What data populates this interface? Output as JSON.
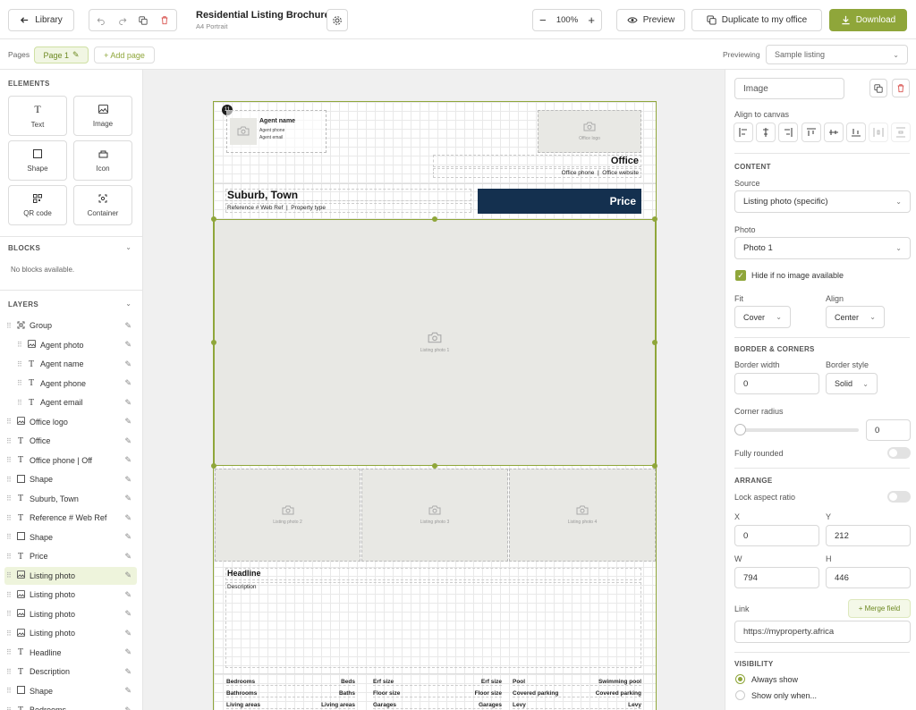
{
  "topbar": {
    "library_label": "Library",
    "doc_title": "Residential Listing Brochure",
    "doc_subtitle": "A4 Portrait",
    "zoom": "100%",
    "preview_label": "Preview",
    "duplicate_label": "Duplicate to my office",
    "download_label": "Download",
    "accent": "#8fa63a"
  },
  "pages_bar": {
    "pages_label": "Pages",
    "current_page": "Page 1",
    "add_page_label": "+ Add page",
    "previewing_label": "Previewing",
    "previewing_value": "Sample listing"
  },
  "left_panel": {
    "elements_title": "ELEMENTS",
    "elements": [
      {
        "label": "Text",
        "icon": "text-icon"
      },
      {
        "label": "Image",
        "icon": "image-icon"
      },
      {
        "label": "Shape",
        "icon": "shape-icon"
      },
      {
        "label": "Icon",
        "icon": "icon-icon"
      },
      {
        "label": "QR code",
        "icon": "qr-icon"
      },
      {
        "label": "Container",
        "icon": "container-icon"
      }
    ],
    "blocks_title": "BLOCKS",
    "blocks_empty": "No blocks available.",
    "layers_title": "LAYERS",
    "layers": [
      {
        "label": "Group",
        "icon": "group-icon",
        "indent": 0
      },
      {
        "label": "Agent photo",
        "icon": "image-icon",
        "indent": 1
      },
      {
        "label": "Agent name",
        "icon": "text-icon",
        "indent": 1
      },
      {
        "label": "Agent phone",
        "icon": "text-icon",
        "indent": 1
      },
      {
        "label": "Agent email",
        "icon": "text-icon",
        "indent": 1
      },
      {
        "label": "Office logo",
        "icon": "image-icon",
        "indent": 0
      },
      {
        "label": "Office",
        "icon": "text-icon",
        "indent": 0
      },
      {
        "label": "Office phone | Off",
        "icon": "text-icon",
        "indent": 0
      },
      {
        "label": "Shape",
        "icon": "shape-icon",
        "indent": 0
      },
      {
        "label": "Suburb, Town",
        "icon": "text-icon",
        "indent": 0
      },
      {
        "label": "Reference # Web Ref",
        "icon": "text-icon",
        "indent": 0
      },
      {
        "label": "Shape",
        "icon": "shape-icon",
        "indent": 0
      },
      {
        "label": "Price",
        "icon": "text-icon",
        "indent": 0
      },
      {
        "label": "Listing photo",
        "icon": "image-icon",
        "indent": 0,
        "selected": true
      },
      {
        "label": "Listing photo",
        "icon": "image-icon",
        "indent": 0
      },
      {
        "label": "Listing photo",
        "icon": "image-icon",
        "indent": 0
      },
      {
        "label": "Listing photo",
        "icon": "image-icon",
        "indent": 0
      },
      {
        "label": "Headline",
        "icon": "text-icon",
        "indent": 0
      },
      {
        "label": "Description",
        "icon": "text-icon",
        "indent": 0
      },
      {
        "label": "Shape",
        "icon": "shape-icon",
        "indent": 0
      },
      {
        "label": "Bedrooms",
        "icon": "text-icon",
        "indent": 0
      }
    ]
  },
  "canvas": {
    "badge": "11",
    "agent_name": "Agent name",
    "agent_phone": "Agent phone",
    "agent_email": "Agent email",
    "office_logo": "Office logo",
    "office": "Office",
    "office_contact": "Office phone  |  Office website",
    "suburb": "Suburb, Town",
    "reference": "Reference # Web Ref  |  Property type",
    "price": "Price",
    "price_bg": "#14304f",
    "photo_main": "Listing photo 1",
    "photo_2": "Listing photo 2",
    "photo_3": "Listing photo 3",
    "photo_4": "Listing photo 4",
    "headline": "Headline",
    "description": "Description",
    "features": [
      [
        "Bedrooms",
        "Beds",
        "Erf size",
        "Erf size",
        "Pool",
        "Swimming pool"
      ],
      [
        "Bathrooms",
        "Baths",
        "Floor size",
        "Floor size",
        "Covered parking",
        "Covered parking"
      ],
      [
        "Living areas",
        "Living areas",
        "Garages",
        "Garages",
        "Levy",
        "Levy"
      ]
    ]
  },
  "right_panel": {
    "element_name": "Image",
    "align_label": "Align to canvas",
    "content_title": "CONTENT",
    "source_label": "Source",
    "source_value": "Listing photo (specific)",
    "photo_label": "Photo",
    "photo_value": "Photo 1",
    "hide_label": "Hide if no image available",
    "hide_checked": true,
    "fit_label": "Fit",
    "fit_value": "Cover",
    "align_field_label": "Align",
    "align_value": "Center",
    "border_title": "BORDER & CORNERS",
    "border_width_label": "Border width",
    "border_width_value": "0",
    "border_style_label": "Border style",
    "border_style_value": "Solid",
    "corner_label": "Corner radius",
    "corner_value": "0",
    "corner_slider_fraction": 0,
    "fully_rounded_label": "Fully rounded",
    "arrange_title": "ARRANGE",
    "lock_label": "Lock aspect ratio",
    "x_label": "X",
    "x_value": "0",
    "y_label": "Y",
    "y_value": "212",
    "w_label": "W",
    "w_value": "794",
    "h_label": "H",
    "h_value": "446",
    "link_label": "Link",
    "merge_label": "+ Merge field",
    "link_value": "https://myproperty.africa",
    "visibility_title": "VISIBILITY",
    "vis_always": "Always show",
    "vis_only": "Show only when..."
  }
}
